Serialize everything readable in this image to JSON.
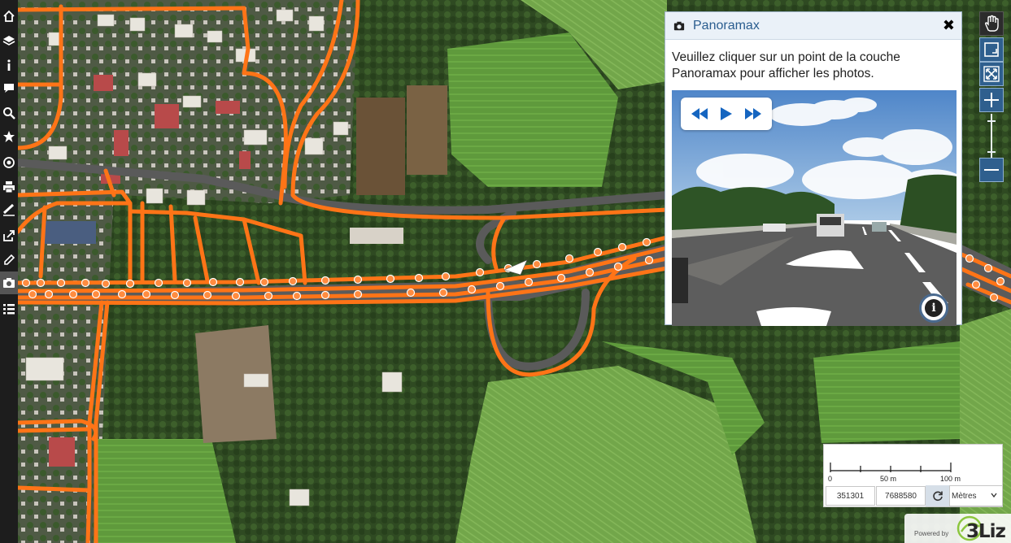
{
  "panel": {
    "title": "Panoramax",
    "message": "Veuillez cliquer sur un point de la couche Panoramax pour afficher les photos.",
    "close_label": "✖",
    "controls": [
      "previous-icon",
      "play-icon",
      "next-icon"
    ],
    "info_label": "i"
  },
  "toolbar": {
    "left_tools": [
      "home-icon",
      "layers-icon",
      "info-icon",
      "comment-icon",
      "search-icon",
      "star-icon",
      "locate-icon",
      "print-icon",
      "measure-icon",
      "share-icon",
      "edit-icon",
      "camera-icon",
      "list-icon"
    ]
  },
  "navigation": {
    "buttons": [
      "pan-hand-icon",
      "zoom-box-icon",
      "zoom-extent-icon",
      "zoom-in-icon",
      "zoom-out-icon"
    ]
  },
  "scale": {
    "labels": [
      "0",
      "50 m",
      "100 m"
    ],
    "coord_x": "351301",
    "coord_y": "7688580",
    "unit": "Mètres"
  },
  "footer": {
    "powered_by": "Powered by",
    "brand": "3Liz"
  },
  "colors": {
    "road_overlay": "#ff7417",
    "nav_button": "#2f5f8e",
    "panel_title": "#2a5d8f",
    "toolbar_bg": "#1d1d1d"
  }
}
